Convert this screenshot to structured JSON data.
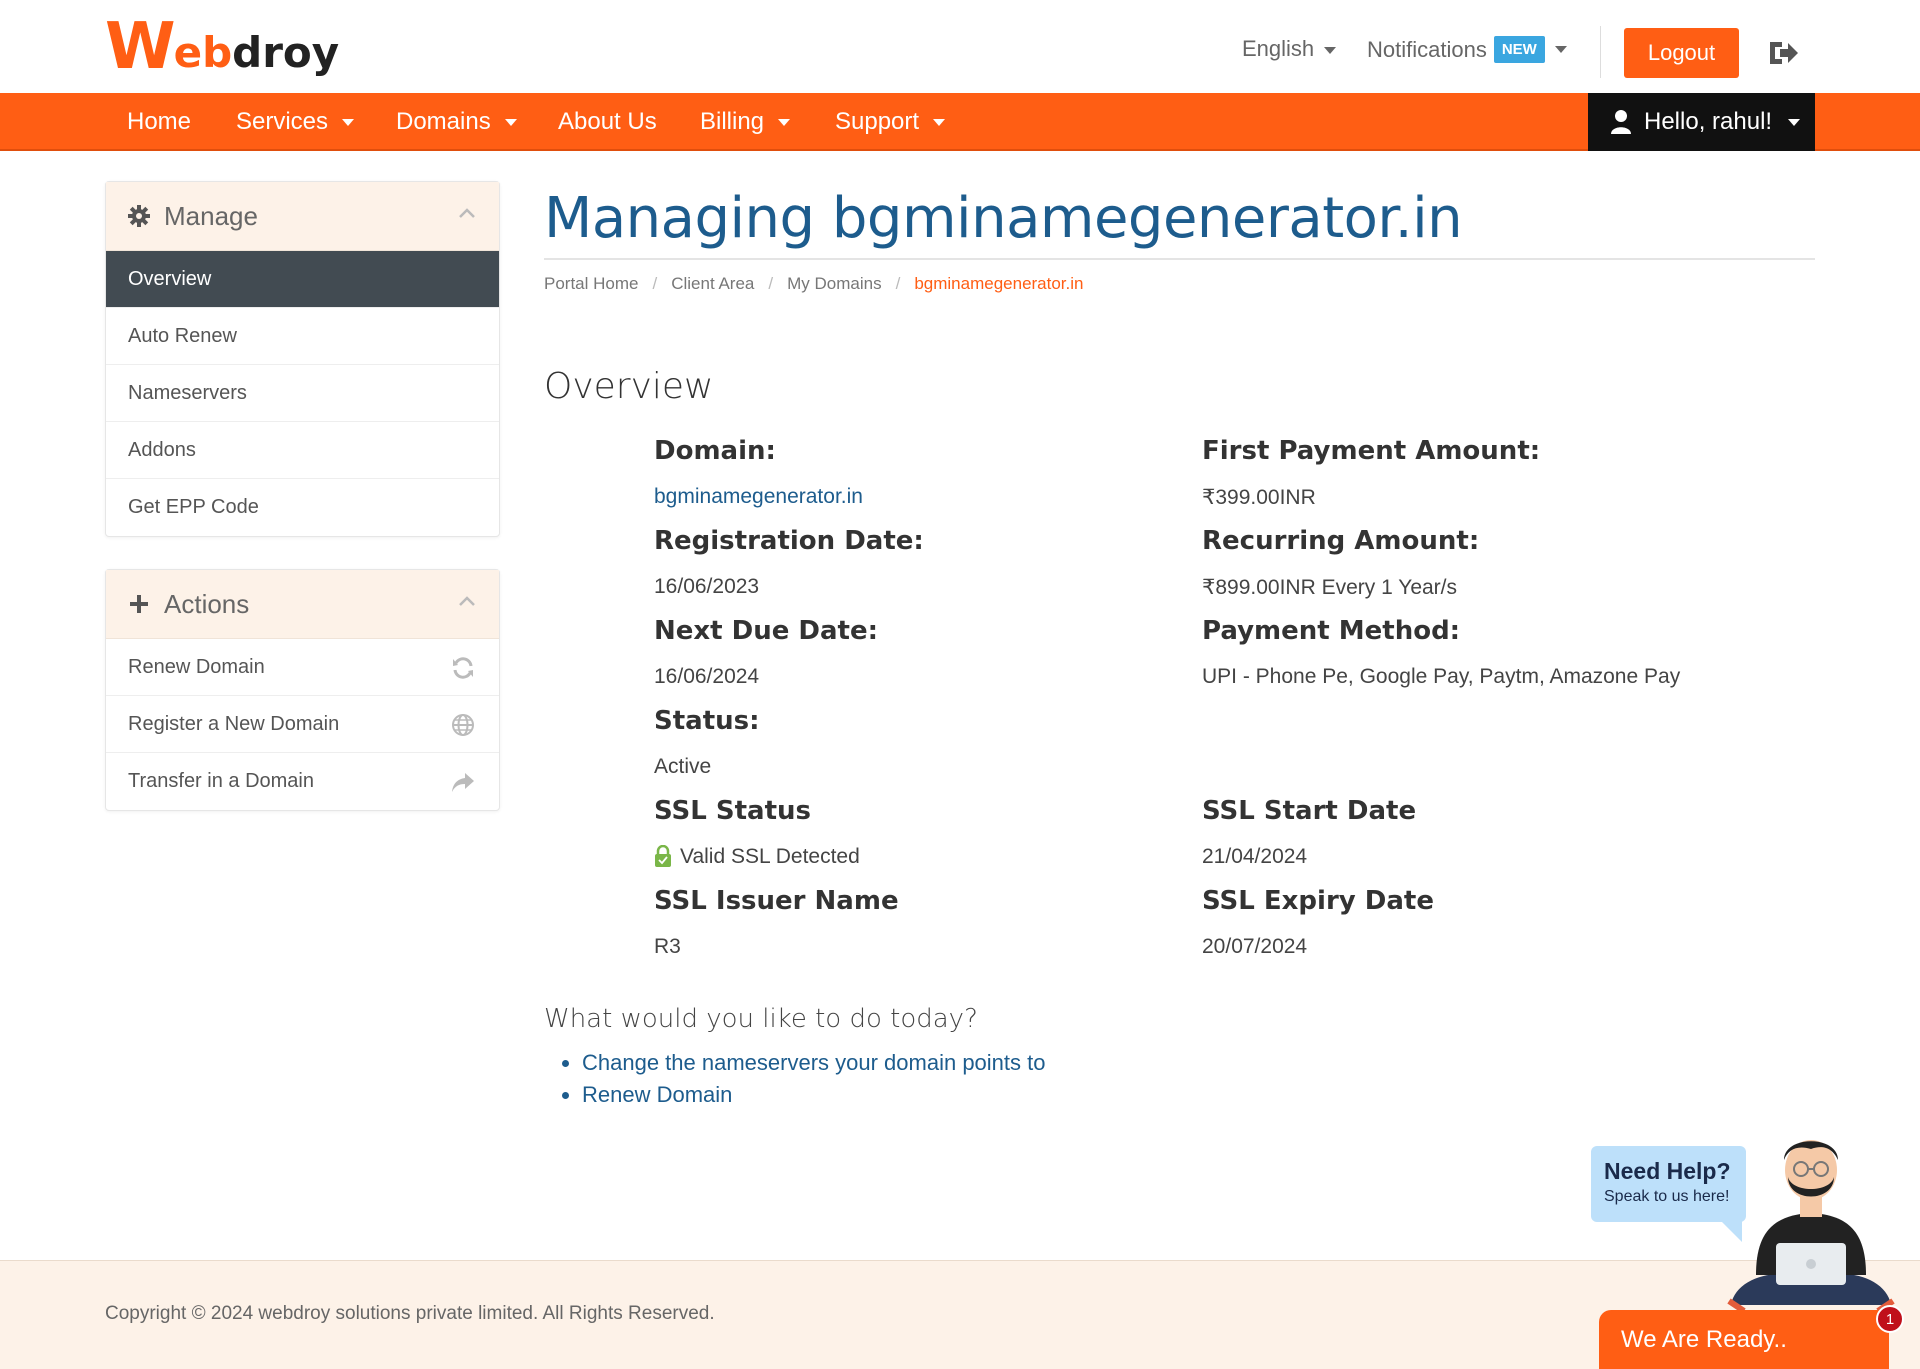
{
  "brand": {
    "logo_w": "W",
    "logo_eb": "eb",
    "logo_droy": "droy"
  },
  "header": {
    "language_label": "English",
    "notifications_label": "Notifications",
    "notifications_badge": "NEW",
    "logout_label": "Logout"
  },
  "nav": {
    "items": [
      "Home",
      "Services",
      "Domains",
      "About Us",
      "Billing",
      "Support"
    ],
    "user_greeting": "Hello, rahul!"
  },
  "sidebar": {
    "manage": {
      "title": "Manage",
      "items": [
        "Overview",
        "Auto Renew",
        "Nameservers",
        "Addons",
        "Get EPP Code"
      ]
    },
    "actions": {
      "title": "Actions",
      "items": [
        "Renew Domain",
        "Register a New Domain",
        "Transfer in a Domain"
      ]
    }
  },
  "main": {
    "title": "Managing bgminamegenerator.in",
    "breadcrumb": [
      "Portal Home",
      "Client Area",
      "My Domains",
      "bgminamegenerator.in"
    ],
    "section_title": "Overview",
    "fields": {
      "domain_label": "Domain:",
      "domain_value": "bgminamegenerator.in",
      "first_payment_label": "First Payment Amount:",
      "first_payment_value": "₹399.00INR",
      "registration_label": "Registration Date:",
      "registration_value": "16/06/2023",
      "recurring_label": "Recurring Amount:",
      "recurring_value": "₹899.00INR Every 1 Year/s",
      "next_due_label": "Next Due Date:",
      "next_due_value": "16/06/2024",
      "payment_method_label": "Payment Method:",
      "payment_method_value": "UPI - Phone Pe, Google Pay, Paytm, Amazone Pay",
      "status_label": "Status:",
      "status_value": "Active",
      "ssl_status_label": "SSL Status",
      "ssl_status_value": "Valid SSL Detected",
      "ssl_start_label": "SSL Start Date",
      "ssl_start_value": "21/04/2024",
      "ssl_issuer_label": "SSL Issuer Name",
      "ssl_issuer_value": "R3",
      "ssl_expiry_label": "SSL Expiry Date",
      "ssl_expiry_value": "20/07/2024"
    },
    "todo_title": "What would you like to do today?",
    "todo_items": [
      "Change the nameservers your domain points to",
      "Renew Domain"
    ]
  },
  "footer": {
    "copyright": "Copyright © 2024 webdroy solutions private limited. All Rights Reserved."
  },
  "help_widget": {
    "title": "Need Help?",
    "subtitle": "Speak to us here!",
    "ready_label": "We Are Ready..",
    "unread_count": "1"
  },
  "colors": {
    "brand": "#ff5e14",
    "title_blue": "#1d5c8d",
    "nav_dark": "#111111",
    "panel_head": "#fdf2e8"
  },
  "icons": {
    "header": [
      "chevron-down-icon",
      "sign-out-icon"
    ],
    "nav": [
      "user-icon"
    ],
    "sidebar": [
      "gear-icon",
      "plus-icon",
      "chevron-up-icon",
      "refresh-icon",
      "globe-icon",
      "share-icon"
    ],
    "main": [
      "lock-icon"
    ]
  }
}
